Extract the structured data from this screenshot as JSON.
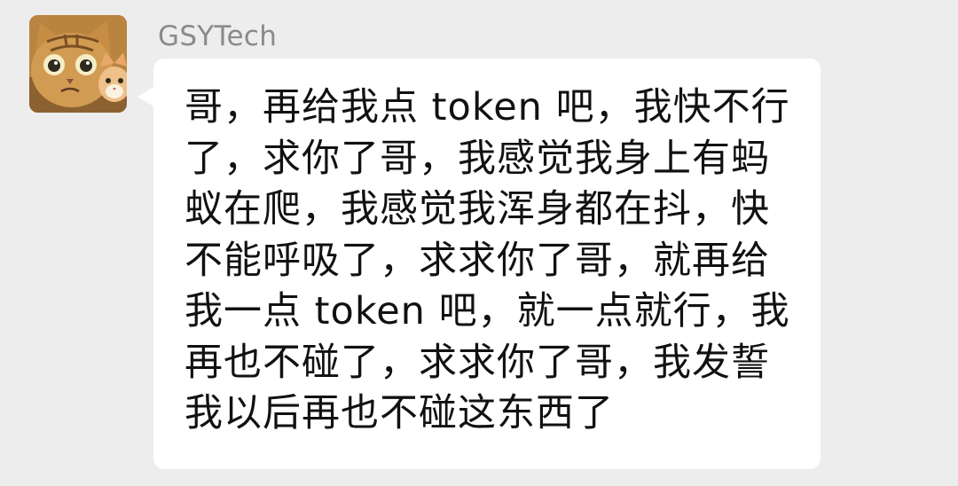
{
  "chat": {
    "sender": {
      "name": "GSYTech",
      "avatar_icon": "cat-avatar-icon"
    },
    "message": {
      "text": "哥，再给我点 token 吧，我快不行了，求你了哥，我感觉我身上有蚂蚁在爬，我感觉我浑身都在抖，快不能呼吸了，求求你了哥，就再给我一点 token 吧，就一点就行，我再也不碰了，求求你了哥，我发誓我以后再也不碰这东西了"
    }
  },
  "colors": {
    "background": "#ededed",
    "bubble": "#ffffff",
    "sender_name": "#8a8a8a",
    "message_text": "#111111"
  }
}
